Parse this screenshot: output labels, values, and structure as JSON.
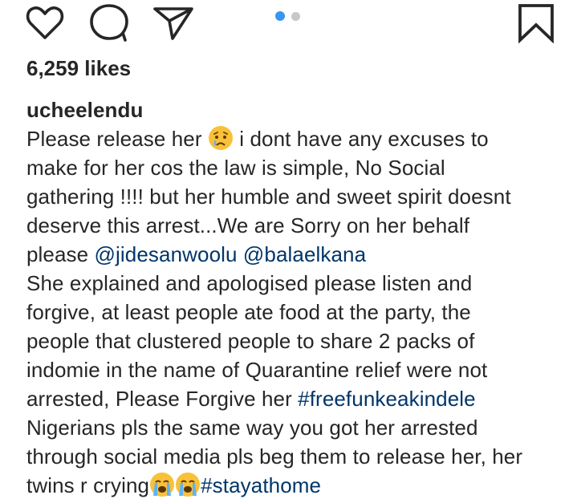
{
  "actions": {
    "like_icon": "heart-outline",
    "comment_icon": "speech-bubble",
    "share_icon": "paper-plane",
    "save_icon": "bookmark-outline",
    "carousel": {
      "count": 2,
      "active": 1,
      "active_color": "#3897f0",
      "inactive_color": "#c7c7c7"
    }
  },
  "likes": "6,259 likes",
  "caption": {
    "username": "ucheelendu",
    "l1a": "Please release her ",
    "l1b": " i dont have any excuses to",
    "l2": "make for her cos the law is simple, No Social",
    "l3": "gathering !!!! but her humble and sweet spirit doesnt",
    "l4": "deserve this arrest...We are Sorry on her behalf",
    "l5a": "please ",
    "mention1": "@jidesanwoolu",
    "l5b": " ",
    "mention2": "@balaelkana",
    "l6": "She explained and apologised please listen and",
    "l7": "forgive, at least people ate food at the party, the",
    "l8": "people that clustered people to share 2 packs of",
    "l9": "indomie in the name of Quarantine relief were not",
    "l10a": "arrested, Please Forgive her ",
    "hashtag1": "#freefunkeakindele",
    "l11": "Nigerians pls the same way you got her arrested",
    "l12": "through social media pls beg them to release her, her",
    "l13a": "twins r crying",
    "hashtag2": "#stayathome"
  },
  "colors": {
    "text": "#262626",
    "link": "#003569",
    "emoji_face": "#f8c13a",
    "tear": "#5fb2f5"
  }
}
